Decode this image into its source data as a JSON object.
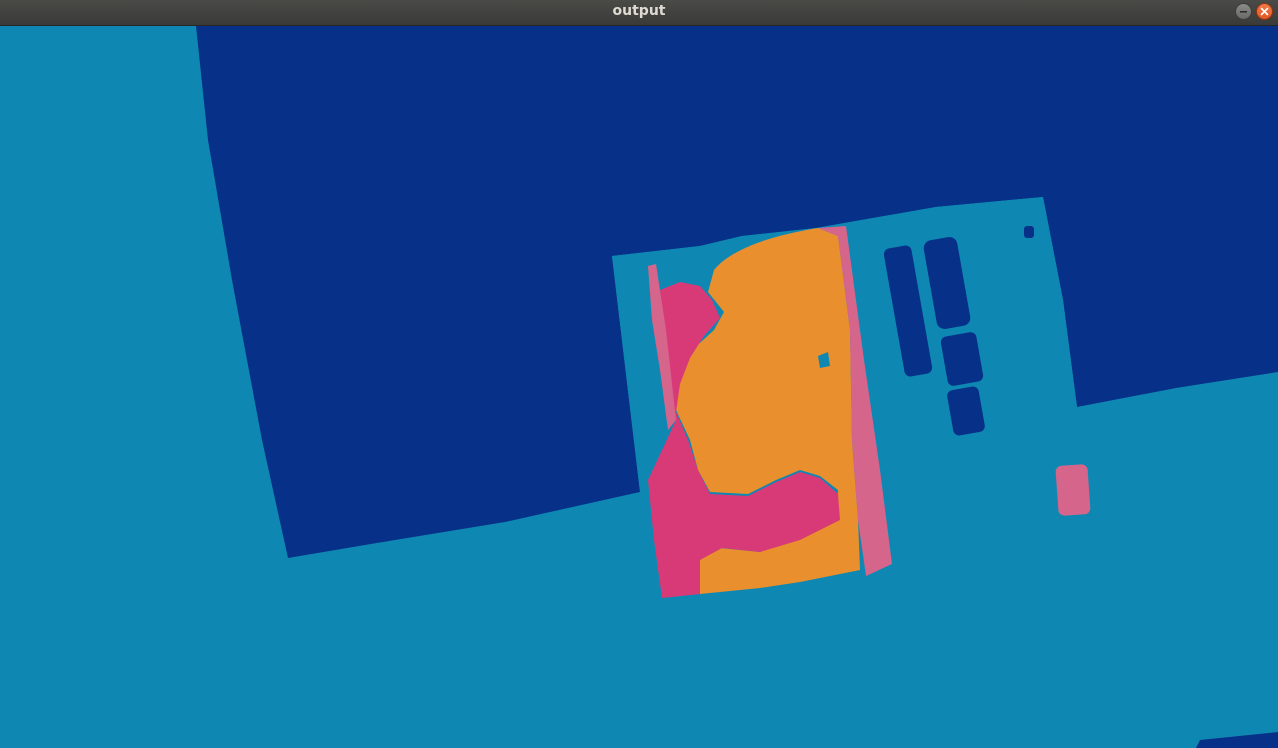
{
  "window": {
    "title": "output"
  },
  "controls": {
    "minimize_icon": "minimize-icon",
    "close_icon": "close-icon"
  },
  "colors": {
    "titlebar": "#3c3b37",
    "background_segment": "#0e88b2",
    "dark_blue_segment": "#073089",
    "orange_segment": "#e98f2e",
    "magenta_segment": "#d83a78",
    "pink_segment": "#d6658c"
  },
  "image": {
    "description_label": "segmentation-output"
  }
}
